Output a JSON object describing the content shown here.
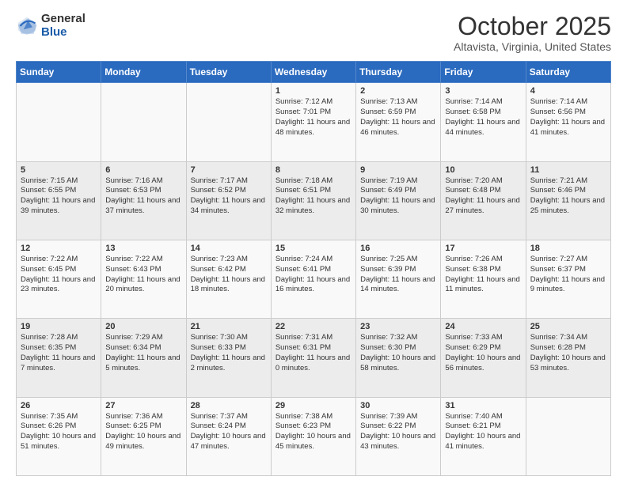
{
  "logo": {
    "general": "General",
    "blue": "Blue"
  },
  "title": "October 2025",
  "location": "Altavista, Virginia, United States",
  "days_of_week": [
    "Sunday",
    "Monday",
    "Tuesday",
    "Wednesday",
    "Thursday",
    "Friday",
    "Saturday"
  ],
  "weeks": [
    [
      {
        "day": "",
        "text": ""
      },
      {
        "day": "",
        "text": ""
      },
      {
        "day": "",
        "text": ""
      },
      {
        "day": "1",
        "text": "Sunrise: 7:12 AM\nSunset: 7:01 PM\nDaylight: 11 hours and 48 minutes."
      },
      {
        "day": "2",
        "text": "Sunrise: 7:13 AM\nSunset: 6:59 PM\nDaylight: 11 hours and 46 minutes."
      },
      {
        "day": "3",
        "text": "Sunrise: 7:14 AM\nSunset: 6:58 PM\nDaylight: 11 hours and 44 minutes."
      },
      {
        "day": "4",
        "text": "Sunrise: 7:14 AM\nSunset: 6:56 PM\nDaylight: 11 hours and 41 minutes."
      }
    ],
    [
      {
        "day": "5",
        "text": "Sunrise: 7:15 AM\nSunset: 6:55 PM\nDaylight: 11 hours and 39 minutes."
      },
      {
        "day": "6",
        "text": "Sunrise: 7:16 AM\nSunset: 6:53 PM\nDaylight: 11 hours and 37 minutes."
      },
      {
        "day": "7",
        "text": "Sunrise: 7:17 AM\nSunset: 6:52 PM\nDaylight: 11 hours and 34 minutes."
      },
      {
        "day": "8",
        "text": "Sunrise: 7:18 AM\nSunset: 6:51 PM\nDaylight: 11 hours and 32 minutes."
      },
      {
        "day": "9",
        "text": "Sunrise: 7:19 AM\nSunset: 6:49 PM\nDaylight: 11 hours and 30 minutes."
      },
      {
        "day": "10",
        "text": "Sunrise: 7:20 AM\nSunset: 6:48 PM\nDaylight: 11 hours and 27 minutes."
      },
      {
        "day": "11",
        "text": "Sunrise: 7:21 AM\nSunset: 6:46 PM\nDaylight: 11 hours and 25 minutes."
      }
    ],
    [
      {
        "day": "12",
        "text": "Sunrise: 7:22 AM\nSunset: 6:45 PM\nDaylight: 11 hours and 23 minutes."
      },
      {
        "day": "13",
        "text": "Sunrise: 7:22 AM\nSunset: 6:43 PM\nDaylight: 11 hours and 20 minutes."
      },
      {
        "day": "14",
        "text": "Sunrise: 7:23 AM\nSunset: 6:42 PM\nDaylight: 11 hours and 18 minutes."
      },
      {
        "day": "15",
        "text": "Sunrise: 7:24 AM\nSunset: 6:41 PM\nDaylight: 11 hours and 16 minutes."
      },
      {
        "day": "16",
        "text": "Sunrise: 7:25 AM\nSunset: 6:39 PM\nDaylight: 11 hours and 14 minutes."
      },
      {
        "day": "17",
        "text": "Sunrise: 7:26 AM\nSunset: 6:38 PM\nDaylight: 11 hours and 11 minutes."
      },
      {
        "day": "18",
        "text": "Sunrise: 7:27 AM\nSunset: 6:37 PM\nDaylight: 11 hours and 9 minutes."
      }
    ],
    [
      {
        "day": "19",
        "text": "Sunrise: 7:28 AM\nSunset: 6:35 PM\nDaylight: 11 hours and 7 minutes."
      },
      {
        "day": "20",
        "text": "Sunrise: 7:29 AM\nSunset: 6:34 PM\nDaylight: 11 hours and 5 minutes."
      },
      {
        "day": "21",
        "text": "Sunrise: 7:30 AM\nSunset: 6:33 PM\nDaylight: 11 hours and 2 minutes."
      },
      {
        "day": "22",
        "text": "Sunrise: 7:31 AM\nSunset: 6:31 PM\nDaylight: 11 hours and 0 minutes."
      },
      {
        "day": "23",
        "text": "Sunrise: 7:32 AM\nSunset: 6:30 PM\nDaylight: 10 hours and 58 minutes."
      },
      {
        "day": "24",
        "text": "Sunrise: 7:33 AM\nSunset: 6:29 PM\nDaylight: 10 hours and 56 minutes."
      },
      {
        "day": "25",
        "text": "Sunrise: 7:34 AM\nSunset: 6:28 PM\nDaylight: 10 hours and 53 minutes."
      }
    ],
    [
      {
        "day": "26",
        "text": "Sunrise: 7:35 AM\nSunset: 6:26 PM\nDaylight: 10 hours and 51 minutes."
      },
      {
        "day": "27",
        "text": "Sunrise: 7:36 AM\nSunset: 6:25 PM\nDaylight: 10 hours and 49 minutes."
      },
      {
        "day": "28",
        "text": "Sunrise: 7:37 AM\nSunset: 6:24 PM\nDaylight: 10 hours and 47 minutes."
      },
      {
        "day": "29",
        "text": "Sunrise: 7:38 AM\nSunset: 6:23 PM\nDaylight: 10 hours and 45 minutes."
      },
      {
        "day": "30",
        "text": "Sunrise: 7:39 AM\nSunset: 6:22 PM\nDaylight: 10 hours and 43 minutes."
      },
      {
        "day": "31",
        "text": "Sunrise: 7:40 AM\nSunset: 6:21 PM\nDaylight: 10 hours and 41 minutes."
      },
      {
        "day": "",
        "text": ""
      }
    ]
  ]
}
